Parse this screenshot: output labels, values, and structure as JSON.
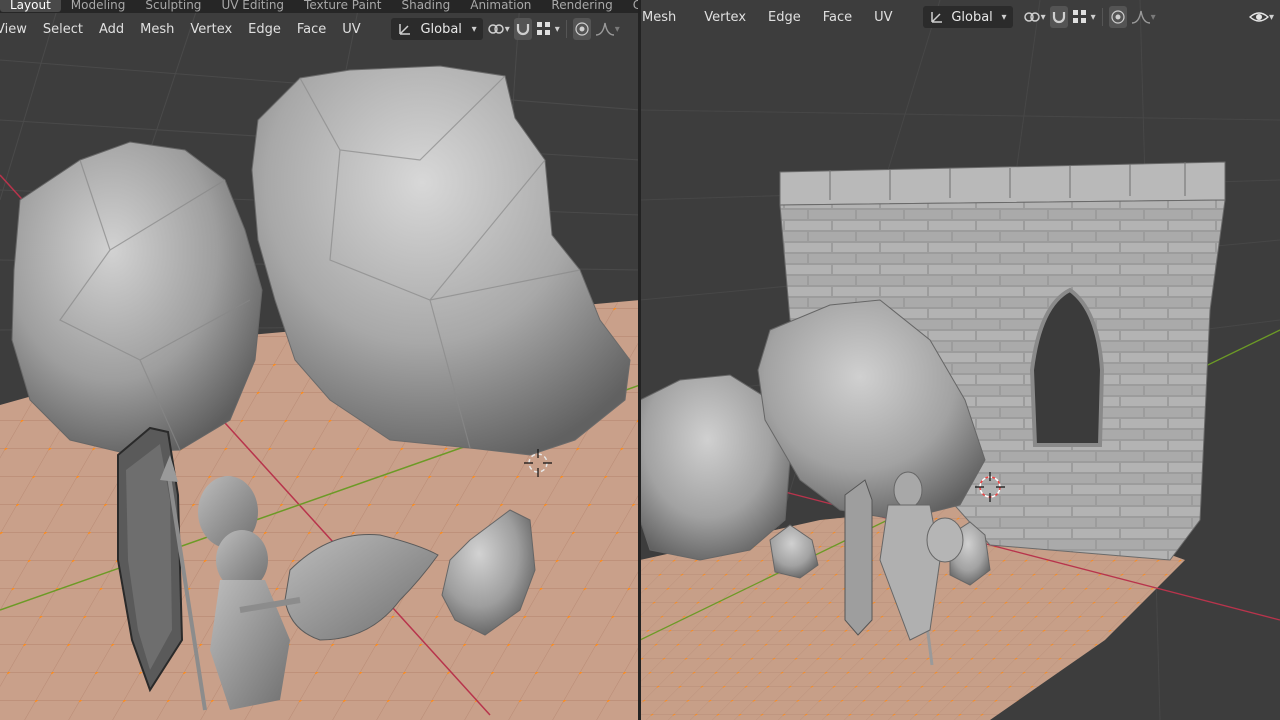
{
  "workspace_tabs": [
    "Layout",
    "Modeling",
    "Sculpting",
    "UV Editing",
    "Texture Paint",
    "Shading",
    "Animation",
    "Rendering",
    "Compositing"
  ],
  "active_workspace": "Layout",
  "left_viewport": {
    "menu": [
      "View",
      "Select",
      "Add",
      "Mesh",
      "Vertex",
      "Edge",
      "Face",
      "UV"
    ],
    "orientation": "Global"
  },
  "right_viewport": {
    "menu": [
      "Mesh",
      "Vertex",
      "Edge",
      "Face",
      "UV"
    ],
    "orientation": "Global"
  },
  "colors": {
    "header_bg": "#2b2b2b",
    "viewport_bg": "#3d3d3d",
    "ground": "#c9a08a",
    "vertex": "#ff8c1a",
    "x_axis": "#b8344c",
    "y_axis": "#6c9a26",
    "mesh": "#a8a8a8"
  },
  "icons": [
    "transform-orientation-icon",
    "pivot-point-icon",
    "snap-magnet-icon",
    "snap-grid-icon",
    "proportional-edit-icon",
    "falloff-curve-icon",
    "visibility-eye-icon"
  ]
}
